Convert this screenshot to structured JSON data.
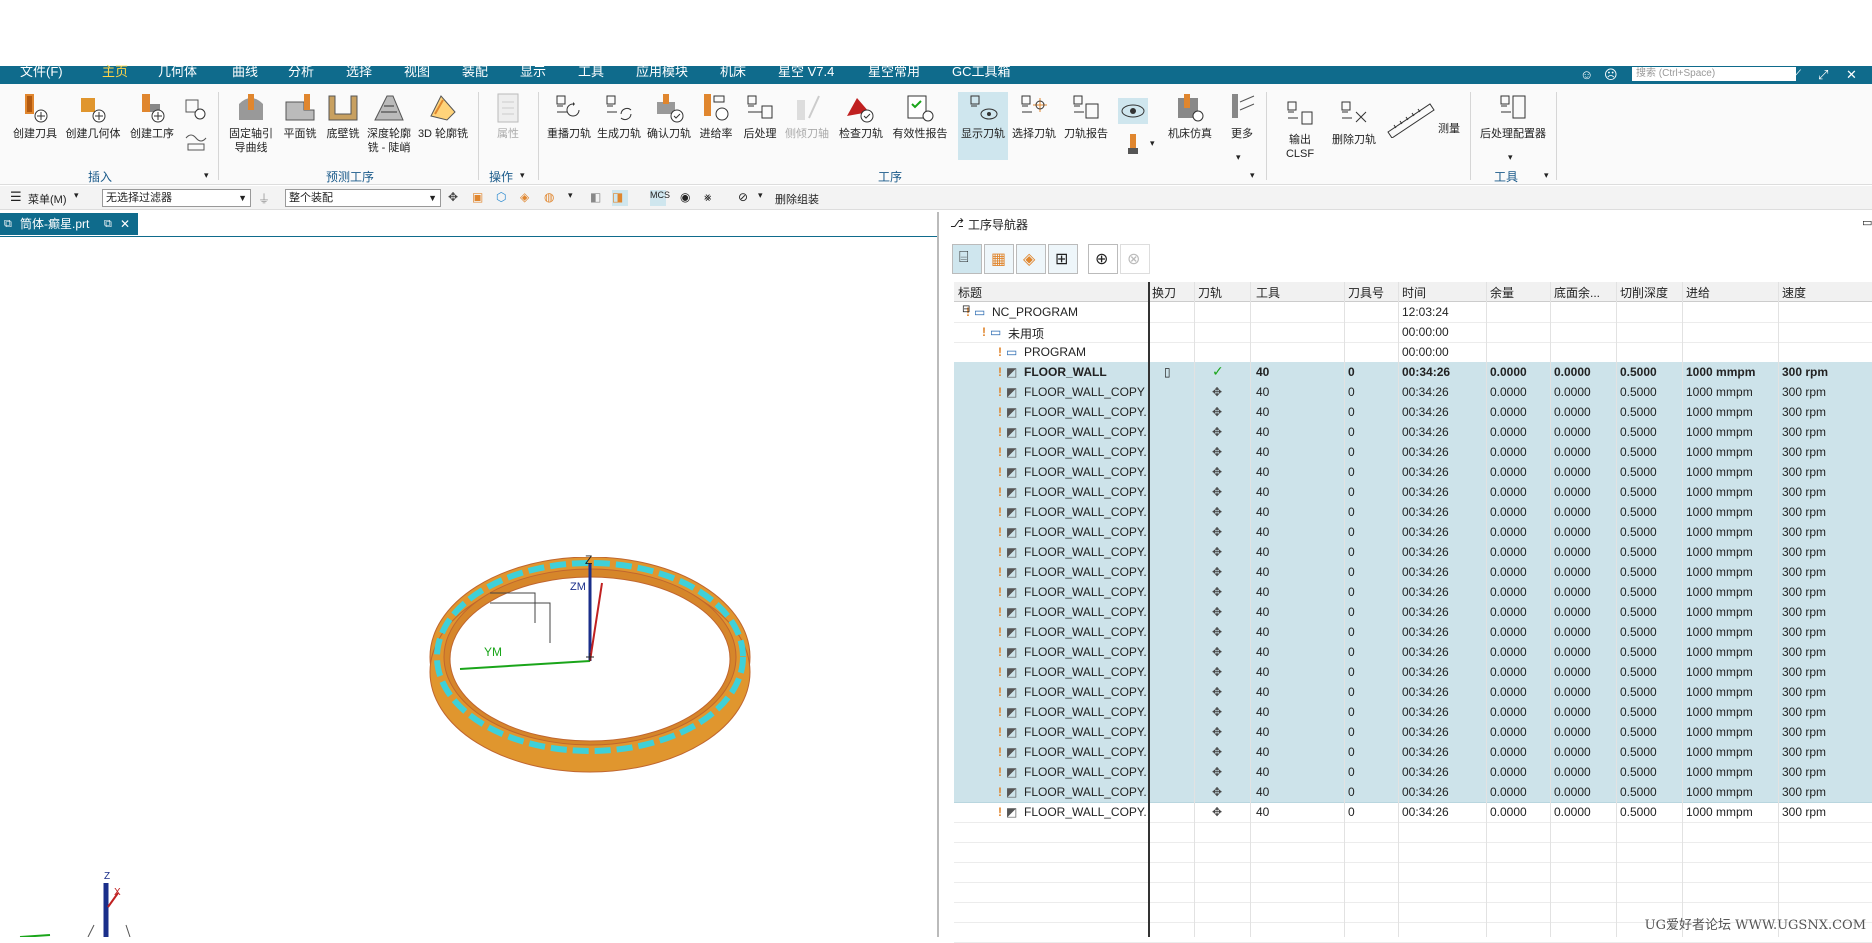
{
  "menubar": {
    "tabs": [
      "文件(F)",
      "主页",
      "几何体",
      "曲线",
      "分析",
      "选择",
      "视图",
      "装配",
      "显示",
      "工具",
      "应用模块",
      "机床",
      "星空 V7.4",
      "星空常用",
      "GC工具箱"
    ],
    "active_index": 1,
    "search_placeholder": "搜索 (Ctrl+Space)"
  },
  "ribbon": {
    "insert": {
      "group": "插入",
      "buttons": [
        "创建刀具",
        "创建几何体",
        "创建工序"
      ]
    },
    "preview": {
      "group": "预测工序",
      "buttons": [
        "固定轴引导曲线",
        "平面铣",
        "底壁铣",
        "深度轮廓铣 - 陡峭",
        "3D 轮廓铣"
      ]
    },
    "ops": {
      "group": "操作",
      "buttons": [
        "属性"
      ]
    },
    "process": {
      "group": "工序",
      "buttons": [
        "重播刀轨",
        "生成刀轨",
        "确认刀轨",
        "进给率",
        "后处理",
        "侧倾刀轴",
        "检查刀轨",
        "有效性报告",
        "显示刀轨",
        "选择刀轨",
        "刀轨报告",
        "机床仿真",
        "更多"
      ]
    },
    "output": {
      "buttons": [
        "输出 CLSF",
        "删除刀轨",
        "测量"
      ]
    },
    "tools": {
      "group": "工具",
      "buttons": [
        "后处理配置器"
      ]
    }
  },
  "toolbar2": {
    "menu_label": "菜单(M)",
    "filter_value": "无选择过滤器",
    "assembly_value": "整个装配",
    "delete_group_label": "删除组装"
  },
  "doc_tab": {
    "label": "筒体-癫星.prt"
  },
  "viewport": {
    "axis_z": "Z",
    "axis_ym": "YM",
    "axis_zm": "ZM",
    "triad_z": "Z",
    "triad_x": "X"
  },
  "navigator": {
    "title": "工序导航器",
    "columns": [
      "标题",
      "换刀",
      "刀轨",
      "工具",
      "刀具号",
      "时间",
      "余量",
      "底面余...",
      "切削深度",
      "进给",
      "速度"
    ],
    "rows": [
      {
        "name": "NC_PROGRAM",
        "time": "12:03:24",
        "level": 0,
        "kind": "program"
      },
      {
        "name": "未用项",
        "time": "00:00:00",
        "level": 1,
        "kind": "folder"
      },
      {
        "name": "PROGRAM",
        "time": "00:00:00",
        "level": 2,
        "kind": "folder"
      },
      {
        "name": "FLOOR_WALL",
        "tool": "40",
        "tool_no": "0",
        "time": "00:34:26",
        "stock": "0.0000",
        "floor": "0.0000",
        "depth": "0.5000",
        "feed": "1000 mmpm",
        "speed": "300 rpm",
        "level": 2,
        "kind": "op",
        "bold": true,
        "check": true
      },
      {
        "name": "FLOOR_WALL_COPY",
        "tool": "40",
        "tool_no": "0",
        "time": "00:34:26",
        "stock": "0.0000",
        "floor": "0.0000",
        "depth": "0.5000",
        "feed": "1000 mmpm",
        "speed": "300 rpm",
        "level": 2,
        "kind": "op"
      },
      {
        "name": "FLOOR_WALL_COPY...",
        "tool": "40",
        "tool_no": "0",
        "time": "00:34:26",
        "stock": "0.0000",
        "floor": "0.0000",
        "depth": "0.5000",
        "feed": "1000 mmpm",
        "speed": "300 rpm",
        "level": 2,
        "kind": "op"
      },
      {
        "name": "FLOOR_WALL_COPY...",
        "tool": "40",
        "tool_no": "0",
        "time": "00:34:26",
        "stock": "0.0000",
        "floor": "0.0000",
        "depth": "0.5000",
        "feed": "1000 mmpm",
        "speed": "300 rpm",
        "level": 2,
        "kind": "op"
      },
      {
        "name": "FLOOR_WALL_COPY...",
        "tool": "40",
        "tool_no": "0",
        "time": "00:34:26",
        "stock": "0.0000",
        "floor": "0.0000",
        "depth": "0.5000",
        "feed": "1000 mmpm",
        "speed": "300 rpm",
        "level": 2,
        "kind": "op"
      },
      {
        "name": "FLOOR_WALL_COPY...",
        "tool": "40",
        "tool_no": "0",
        "time": "00:34:26",
        "stock": "0.0000",
        "floor": "0.0000",
        "depth": "0.5000",
        "feed": "1000 mmpm",
        "speed": "300 rpm",
        "level": 2,
        "kind": "op"
      },
      {
        "name": "FLOOR_WALL_COPY...",
        "tool": "40",
        "tool_no": "0",
        "time": "00:34:26",
        "stock": "0.0000",
        "floor": "0.0000",
        "depth": "0.5000",
        "feed": "1000 mmpm",
        "speed": "300 rpm",
        "level": 2,
        "kind": "op"
      },
      {
        "name": "FLOOR_WALL_COPY...",
        "tool": "40",
        "tool_no": "0",
        "time": "00:34:26",
        "stock": "0.0000",
        "floor": "0.0000",
        "depth": "0.5000",
        "feed": "1000 mmpm",
        "speed": "300 rpm",
        "level": 2,
        "kind": "op"
      },
      {
        "name": "FLOOR_WALL_COPY...",
        "tool": "40",
        "tool_no": "0",
        "time": "00:34:26",
        "stock": "0.0000",
        "floor": "0.0000",
        "depth": "0.5000",
        "feed": "1000 mmpm",
        "speed": "300 rpm",
        "level": 2,
        "kind": "op"
      },
      {
        "name": "FLOOR_WALL_COPY...",
        "tool": "40",
        "tool_no": "0",
        "time": "00:34:26",
        "stock": "0.0000",
        "floor": "0.0000",
        "depth": "0.5000",
        "feed": "1000 mmpm",
        "speed": "300 rpm",
        "level": 2,
        "kind": "op"
      },
      {
        "name": "FLOOR_WALL_COPY...",
        "tool": "40",
        "tool_no": "0",
        "time": "00:34:26",
        "stock": "0.0000",
        "floor": "0.0000",
        "depth": "0.5000",
        "feed": "1000 mmpm",
        "speed": "300 rpm",
        "level": 2,
        "kind": "op"
      },
      {
        "name": "FLOOR_WALL_COPY...",
        "tool": "40",
        "tool_no": "0",
        "time": "00:34:26",
        "stock": "0.0000",
        "floor": "0.0000",
        "depth": "0.5000",
        "feed": "1000 mmpm",
        "speed": "300 rpm",
        "level": 2,
        "kind": "op"
      },
      {
        "name": "FLOOR_WALL_COPY...",
        "tool": "40",
        "tool_no": "0",
        "time": "00:34:26",
        "stock": "0.0000",
        "floor": "0.0000",
        "depth": "0.5000",
        "feed": "1000 mmpm",
        "speed": "300 rpm",
        "level": 2,
        "kind": "op"
      },
      {
        "name": "FLOOR_WALL_COPY...",
        "tool": "40",
        "tool_no": "0",
        "time": "00:34:26",
        "stock": "0.0000",
        "floor": "0.0000",
        "depth": "0.5000",
        "feed": "1000 mmpm",
        "speed": "300 rpm",
        "level": 2,
        "kind": "op"
      },
      {
        "name": "FLOOR_WALL_COPY...",
        "tool": "40",
        "tool_no": "0",
        "time": "00:34:26",
        "stock": "0.0000",
        "floor": "0.0000",
        "depth": "0.5000",
        "feed": "1000 mmpm",
        "speed": "300 rpm",
        "level": 2,
        "kind": "op"
      },
      {
        "name": "FLOOR_WALL_COPY...",
        "tool": "40",
        "tool_no": "0",
        "time": "00:34:26",
        "stock": "0.0000",
        "floor": "0.0000",
        "depth": "0.5000",
        "feed": "1000 mmpm",
        "speed": "300 rpm",
        "level": 2,
        "kind": "op"
      },
      {
        "name": "FLOOR_WALL_COPY...",
        "tool": "40",
        "tool_no": "0",
        "time": "00:34:26",
        "stock": "0.0000",
        "floor": "0.0000",
        "depth": "0.5000",
        "feed": "1000 mmpm",
        "speed": "300 rpm",
        "level": 2,
        "kind": "op"
      },
      {
        "name": "FLOOR_WALL_COPY...",
        "tool": "40",
        "tool_no": "0",
        "time": "00:34:26",
        "stock": "0.0000",
        "floor": "0.0000",
        "depth": "0.5000",
        "feed": "1000 mmpm",
        "speed": "300 rpm",
        "level": 2,
        "kind": "op"
      },
      {
        "name": "FLOOR_WALL_COPY...",
        "tool": "40",
        "tool_no": "0",
        "time": "00:34:26",
        "stock": "0.0000",
        "floor": "0.0000",
        "depth": "0.5000",
        "feed": "1000 mmpm",
        "speed": "300 rpm",
        "level": 2,
        "kind": "op"
      },
      {
        "name": "FLOOR_WALL_COPY...",
        "tool": "40",
        "tool_no": "0",
        "time": "00:34:26",
        "stock": "0.0000",
        "floor": "0.0000",
        "depth": "0.5000",
        "feed": "1000 mmpm",
        "speed": "300 rpm",
        "level": 2,
        "kind": "op"
      },
      {
        "name": "FLOOR_WALL_COPY...",
        "tool": "40",
        "tool_no": "0",
        "time": "00:34:26",
        "stock": "0.0000",
        "floor": "0.0000",
        "depth": "0.5000",
        "feed": "1000 mmpm",
        "speed": "300 rpm",
        "level": 2,
        "kind": "op"
      },
      {
        "name": "FLOOR_WALL_COPY...",
        "tool": "40",
        "tool_no": "0",
        "time": "00:34:26",
        "stock": "0.0000",
        "floor": "0.0000",
        "depth": "0.5000",
        "feed": "1000 mmpm",
        "speed": "300 rpm",
        "level": 2,
        "kind": "op"
      },
      {
        "name": "FLOOR_WALL_COPY...",
        "tool": "40",
        "tool_no": "0",
        "time": "00:34:26",
        "stock": "0.0000",
        "floor": "0.0000",
        "depth": "0.5000",
        "feed": "1000 mmpm",
        "speed": "300 rpm",
        "level": 2,
        "kind": "op"
      }
    ],
    "highlight_count": 22
  },
  "watermark": "UG爱好者论坛 WWW.UGSNX.COM",
  "colors": {
    "accent": "#0f6b8c",
    "highlight": "#cde3ea",
    "part": "#e0962e",
    "slot": "#3fd0d8",
    "check": "#1aa51a"
  }
}
